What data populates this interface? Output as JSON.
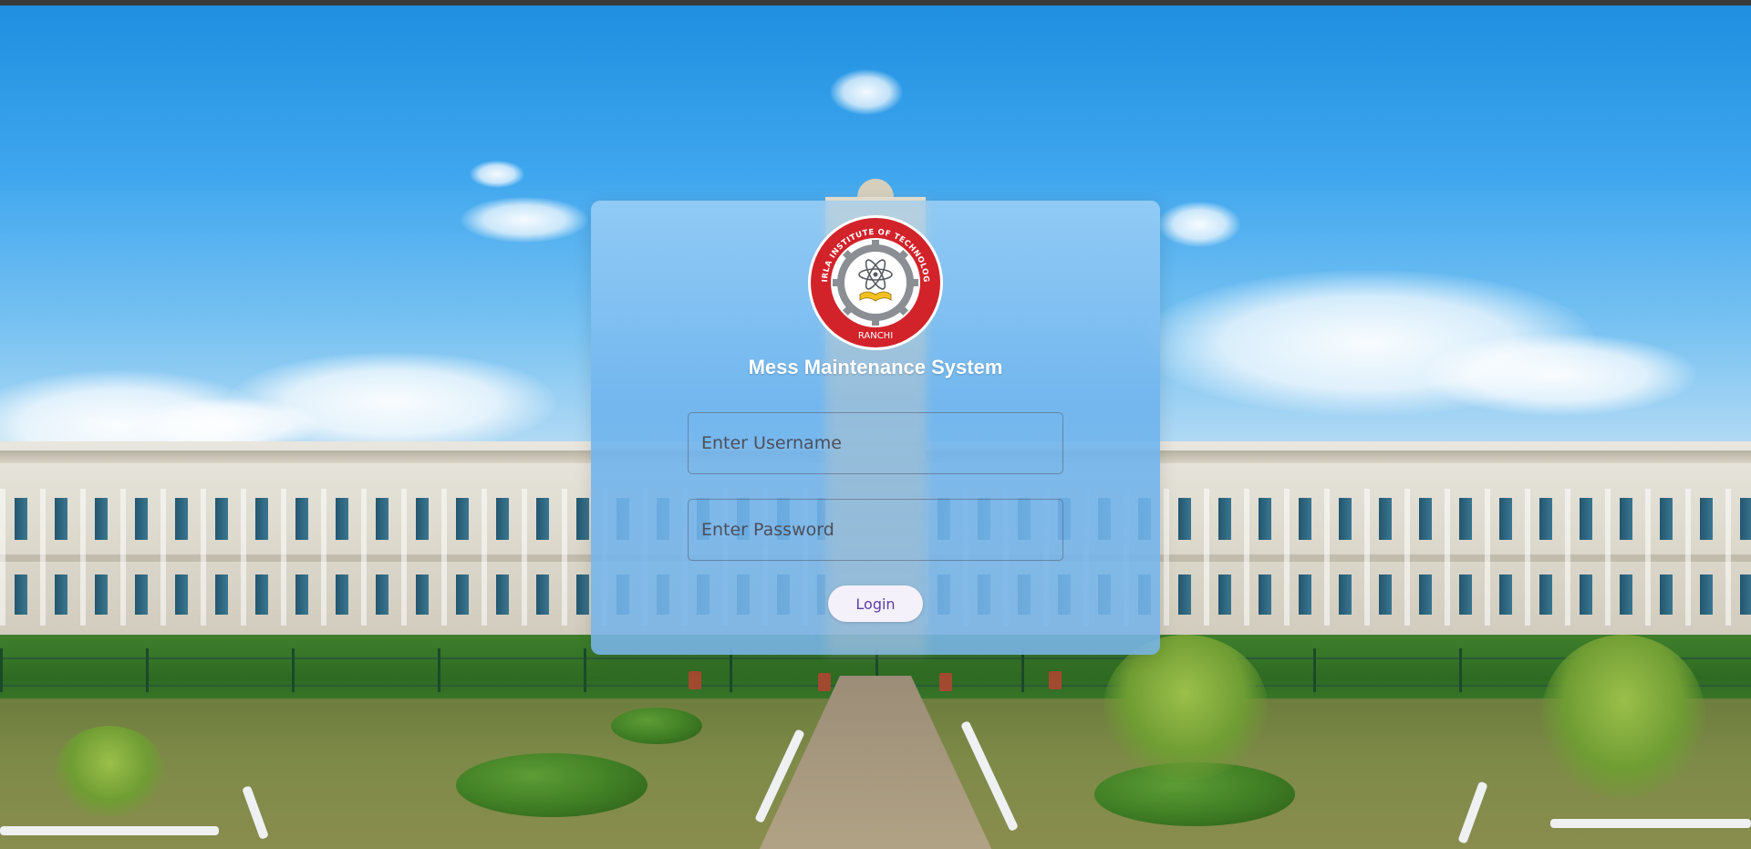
{
  "app": {
    "title": "Mess Maintenance System"
  },
  "logo": {
    "icon": "institute-seal-icon",
    "institution_text": "BIRLA INSTITUTE OF TECHNOLOGY",
    "location_text": "RANCHI"
  },
  "form": {
    "username_placeholder": "Enter Username",
    "username_value": "",
    "password_placeholder": "Enter Password",
    "password_value": "",
    "login_label": "Login"
  },
  "colors": {
    "card_background": "#7ab8ee",
    "title_text": "#ffffff",
    "button_background": "#f4f1fa",
    "button_text": "#5b3fa6",
    "seal_red": "#d2232a"
  }
}
